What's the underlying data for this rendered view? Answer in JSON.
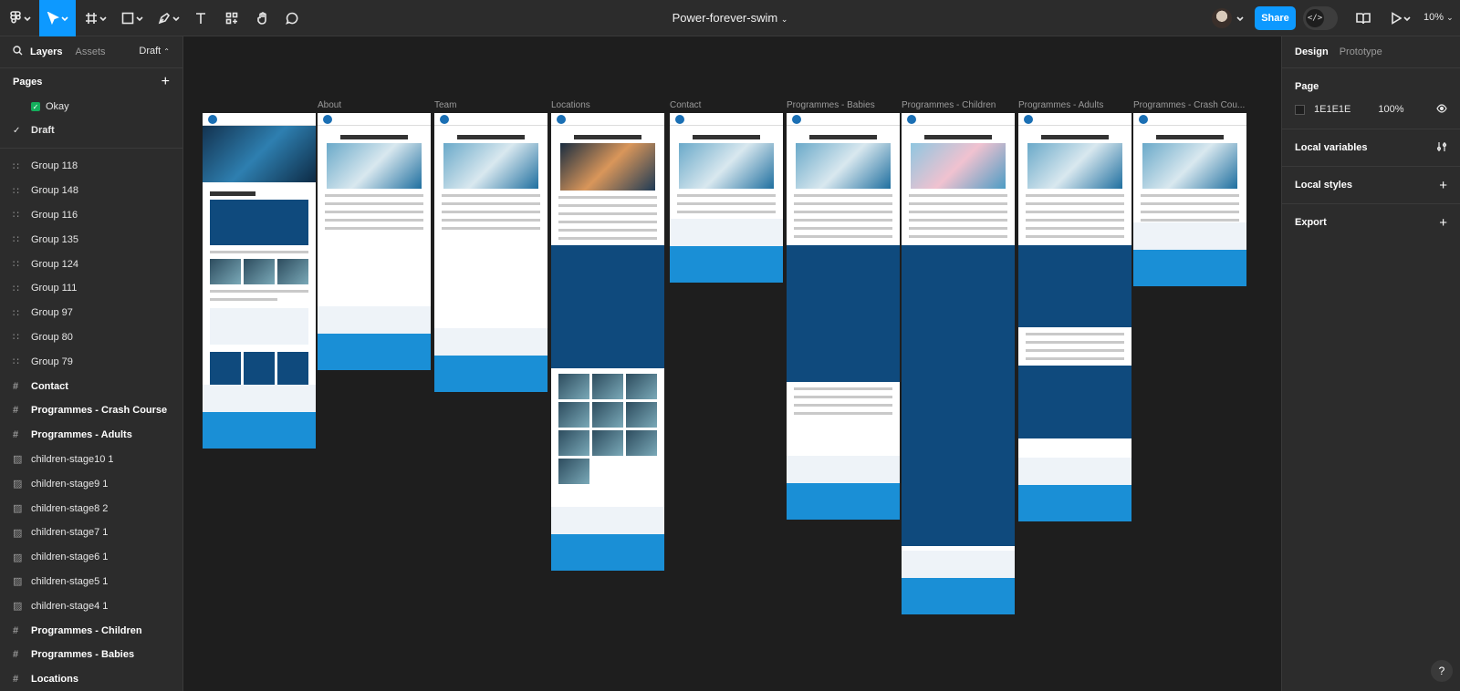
{
  "toolbar": {
    "doc_title": "Power-forever-swim",
    "share_label": "Share",
    "dev_mode_glyph": "</>",
    "zoom_label": "10%",
    "icons": [
      "figma-menu-icon",
      "move-icon",
      "frame-icon",
      "rectangle-icon",
      "pen-icon",
      "text-icon",
      "components-icon",
      "hand-icon",
      "comment-icon",
      "library-icon",
      "present-icon"
    ]
  },
  "left_panel": {
    "tabs": [
      "Layers",
      "Assets"
    ],
    "page_dropdown": "Draft",
    "pages_title": "Pages",
    "pages": [
      {
        "label": "Okay",
        "status": "green-check"
      },
      {
        "label": "Draft",
        "status": "current"
      }
    ],
    "layers": [
      {
        "label": "Group 118",
        "kind": "group"
      },
      {
        "label": "Group 148",
        "kind": "group"
      },
      {
        "label": "Group 116",
        "kind": "group"
      },
      {
        "label": "Group 135",
        "kind": "group"
      },
      {
        "label": "Group 124",
        "kind": "group"
      },
      {
        "label": "Group 111",
        "kind": "group"
      },
      {
        "label": "Group 97",
        "kind": "group"
      },
      {
        "label": "Group 80",
        "kind": "group"
      },
      {
        "label": "Group 79",
        "kind": "group"
      },
      {
        "label": "Contact",
        "kind": "frame"
      },
      {
        "label": "Programmes - Crash Course",
        "kind": "frame"
      },
      {
        "label": "Programmes - Adults",
        "kind": "frame"
      },
      {
        "label": "children-stage10 1",
        "kind": "image"
      },
      {
        "label": "children-stage9 1",
        "kind": "image"
      },
      {
        "label": "children-stage8 2",
        "kind": "image"
      },
      {
        "label": "children-stage7 1",
        "kind": "image"
      },
      {
        "label": "children-stage6 1",
        "kind": "image"
      },
      {
        "label": "children-stage5 1",
        "kind": "image"
      },
      {
        "label": "children-stage4 1",
        "kind": "image"
      },
      {
        "label": "Programmes - Children",
        "kind": "frame"
      },
      {
        "label": "Programmes - Babies",
        "kind": "frame"
      },
      {
        "label": "Locations",
        "kind": "frame"
      }
    ]
  },
  "right_panel": {
    "tabs": [
      "Design",
      "Prototype"
    ],
    "page_section_title": "Page",
    "page_color": "1E1E1E",
    "page_opacity": "100%",
    "sections": [
      "Local variables",
      "Local styles",
      "Export"
    ]
  },
  "canvas": {
    "frames": [
      {
        "label": "",
        "variant": "home"
      },
      {
        "label": "About",
        "variant": "about"
      },
      {
        "label": "Team",
        "variant": "team"
      },
      {
        "label": "Locations",
        "variant": "locations"
      },
      {
        "label": "Contact",
        "variant": "contact"
      },
      {
        "label": "Programmes - Babies",
        "variant": "babies"
      },
      {
        "label": "Programmes - Children",
        "variant": "children"
      },
      {
        "label": "Programmes - Adults",
        "variant": "adults"
      },
      {
        "label": "Programmes - Crash Cou...",
        "variant": "crash"
      }
    ]
  },
  "colors": {
    "accent": "#0d99ff",
    "panel": "#2c2c2c",
    "canvas": "#1e1e1e",
    "site_blue": "#1a8fd6",
    "site_navy": "#0f4a7d"
  }
}
